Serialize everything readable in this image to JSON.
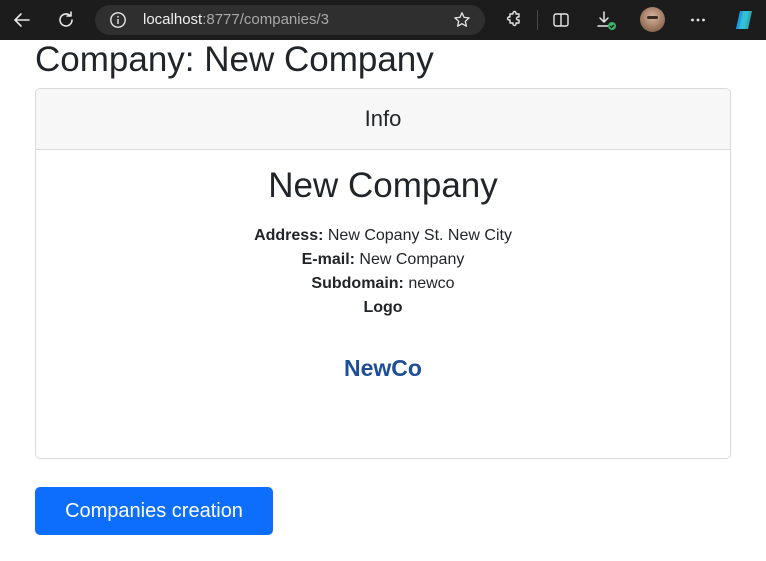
{
  "browser": {
    "url_host": "localhost",
    "url_path": ":8777/companies/3",
    "icons": [
      "back-icon",
      "refresh-icon",
      "info-icon",
      "star-icon",
      "extensions-icon",
      "split-screen-icon",
      "downloads-icon",
      "profile-avatar",
      "more-icon",
      "copilot-icon"
    ]
  },
  "page": {
    "title": "Company: New Company"
  },
  "card": {
    "header": "Info",
    "company_name": "New Company",
    "address_label": "Address:",
    "address_value": "New Copany St. New City",
    "email_label": "E-mail:",
    "email_value": "New Company",
    "subdomain_label": "Subdomain:",
    "subdomain_value": "newco",
    "logo_label": "Logo",
    "logo_text": "NewCo"
  },
  "actions": {
    "companies_creation_label": "Companies creation"
  },
  "colors": {
    "primary": "#0d6efd",
    "logo": "#1f4e99",
    "toolbar": "#1c1c1c"
  }
}
